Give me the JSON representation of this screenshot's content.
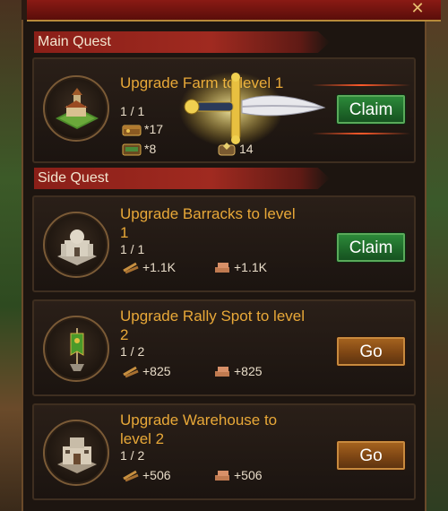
{
  "close_glyph": "✕",
  "main_quest": {
    "section_title": "Main Quest",
    "title": "Upgrade Farm to level 1",
    "progress": "1 / 1",
    "rewards": {
      "food": "*17",
      "xp": "*8",
      "gems": "14"
    },
    "button_label": "Claim",
    "icon": "farm-icon"
  },
  "side_quest": {
    "section_title": "Side Quest",
    "quests": [
      {
        "title_line1": "Upgrade Barracks to level",
        "title_line2": "1",
        "progress": "1 / 1",
        "wood": "+1.1K",
        "stone": "+1.1K",
        "button_label": "Claim",
        "icon": "barracks-icon"
      },
      {
        "title_line1": "Upgrade Rally Spot to level",
        "title_line2": "2",
        "progress": "1 / 2",
        "wood": "+825",
        "stone": "+825",
        "button_label": "Go",
        "icon": "rally-spot-icon"
      },
      {
        "title_line1": "Upgrade Warehouse to",
        "title_line2": "level 2",
        "progress": "1 / 2",
        "wood": "+506",
        "stone": "+506",
        "button_label": "Go",
        "icon": "warehouse-icon"
      }
    ]
  },
  "colors": {
    "quest_title": "#e8a838",
    "claim_button": "#1f6a2a",
    "go_button": "#7e4614",
    "section_banner": "#a02a20"
  }
}
